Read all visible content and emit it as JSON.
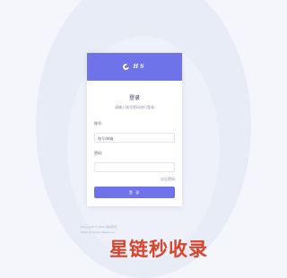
{
  "header": {
    "logo_text": "HS"
  },
  "login": {
    "title": "登录",
    "subtitle": "请输入账号密码进行登录",
    "account_label": "账号:",
    "account_placeholder": "账号/邮箱",
    "password_label": "密码:",
    "password_placeholder": "",
    "forgot_label": "忘记密码",
    "submit_label": "登 录"
  },
  "footer": {
    "line1": "Copyright © 2020  版权所有",
    "line2": "2020  All Rights Reserved"
  },
  "watermark": {
    "text": "星链秒收录"
  },
  "colors": {
    "accent": "#6f73ea",
    "watermark": "#d8452a"
  }
}
